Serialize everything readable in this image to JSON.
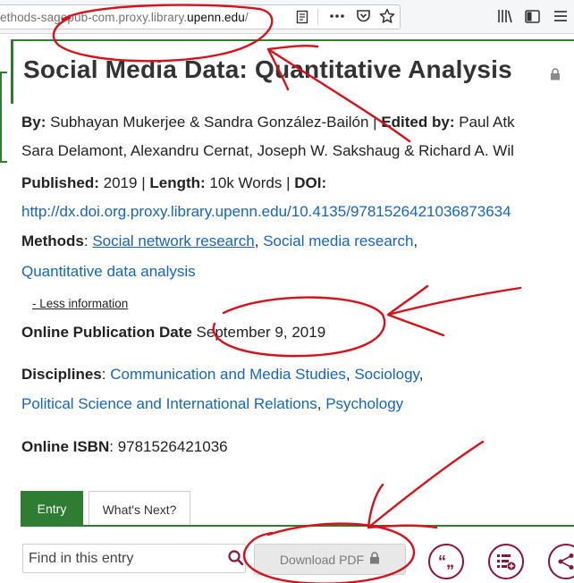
{
  "browser": {
    "url_prefix": "ethods-sagepub-com.proxy.library.",
    "url_host": "upenn.edu",
    "url_suffix": "/",
    "icons": [
      "reader-view-icon",
      "more-actions-icon",
      "pocket-icon",
      "bookmark-star-icon",
      "library-icon",
      "sidebar-icon",
      "menu-icon"
    ]
  },
  "article": {
    "title": "Social Media Data: Quantitative Analysis",
    "by_label": "By:",
    "authors": "Subhayan Mukerjee & Sandra González-Bailón",
    "edited_label": "Edited by:",
    "editors_line1": "Paul Atk",
    "editors_line2": "Sara Delamont, Alexandru Cernat, Joseph W. Sakshaug & Richard A. Wil",
    "published_label": "Published:",
    "published_value": "2019",
    "length_label": "Length:",
    "length_value": "10k Words",
    "doi_label": "DOI:",
    "doi_link": "http://dx.doi.org.proxy.library.upenn.edu/10.4135/9781526421036873634",
    "methods_label": "Methods",
    "methods": [
      "Social network research",
      "Social media research",
      "Quantitative data analysis"
    ],
    "less_info": "- Less information",
    "online_pub_label": "Online Publication Date",
    "online_pub_value": "September 9, 2019",
    "disciplines_label": "Disciplines",
    "disciplines": [
      "Communication and Media Studies",
      "Sociology",
      "Political Science and International Relations",
      "Psychology"
    ],
    "isbn_label": "Online ISBN",
    "isbn_value": "9781526421036"
  },
  "tabs": [
    {
      "label": "Entry",
      "active": true
    },
    {
      "label": "What's Next?",
      "active": false
    }
  ],
  "actions": {
    "find_placeholder": "Find in this entry",
    "download_label": "Download PDF",
    "cite_glyph": "“„"
  },
  "colors": {
    "accent_green": "#2e7d32",
    "link_blue": "#1565c0",
    "action_maroon": "#8b1538",
    "annotation_red": "#d8101a"
  }
}
